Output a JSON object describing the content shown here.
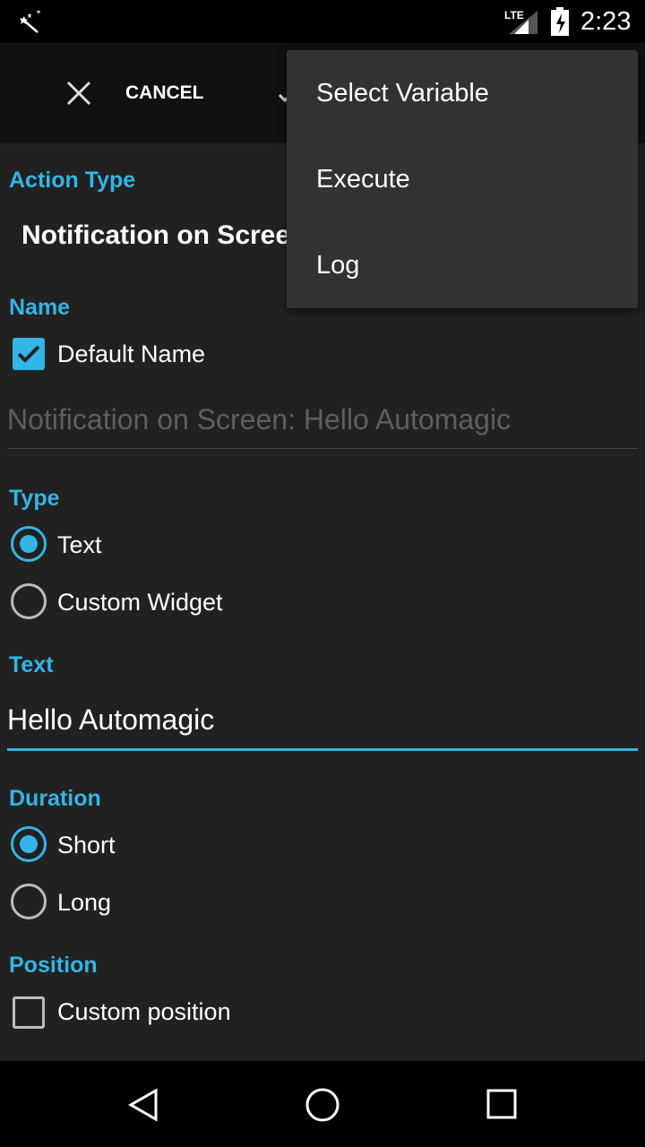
{
  "status_bar": {
    "time": "2:23",
    "network": "LTE",
    "app_icon": "magic-wand-icon"
  },
  "toolbar": {
    "cancel_label": "CANCEL"
  },
  "overflow_menu": {
    "items": [
      "Select Variable",
      "Execute",
      "Log"
    ]
  },
  "form": {
    "action_type_label": "Action Type",
    "action_type_value": "Notification on Screen",
    "name_label": "Name",
    "default_name_label": "Default Name",
    "default_name_checked": true,
    "name_placeholder": "Notification on Screen: Hello Automagic",
    "type_label": "Type",
    "type_options": [
      "Text",
      "Custom Widget"
    ],
    "type_selected": "Text",
    "text_label": "Text",
    "text_value": "Hello Automagic",
    "duration_label": "Duration",
    "duration_options": [
      "Short",
      "Long"
    ],
    "duration_selected": "Short",
    "position_label": "Position",
    "custom_position_label": "Custom position",
    "custom_position_checked": false
  },
  "colors": {
    "accent": "#33b5e5",
    "background": "#212121",
    "menu": "#323232"
  }
}
